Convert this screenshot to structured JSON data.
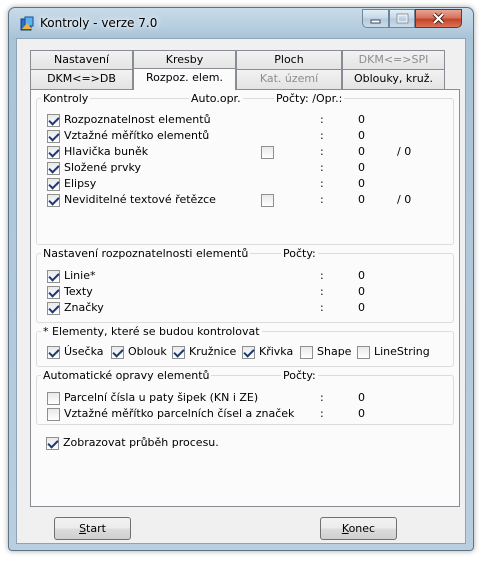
{
  "window": {
    "title": "Kontroly - verze 7.0"
  },
  "tabs_row1": [
    "Nastavení",
    "Kresby",
    "Ploch",
    "DKM<=>SPI"
  ],
  "tabs_row2": [
    "DKM<=>DB",
    "Rozpoz. elem.",
    "Kat. území",
    "Oblouky, kruž."
  ],
  "kontroly": {
    "title": "Kontroly",
    "col_auto": "Auto.opr.",
    "col_counts": "Počty: /Opr.:",
    "items": [
      {
        "label": "Rozpoznatelnost elementů",
        "checked": true,
        "auto": null,
        "colon": ":",
        "count": "0",
        "opr": ""
      },
      {
        "label": "Vztažné měřítko elementů",
        "checked": true,
        "auto": null,
        "colon": ":",
        "count": "0",
        "opr": ""
      },
      {
        "label": "Hlavička buněk",
        "checked": true,
        "auto": false,
        "colon": ":",
        "count": "0",
        "opr": "/ 0"
      },
      {
        "label": "Složené prvky",
        "checked": true,
        "auto": null,
        "colon": ":",
        "count": "0",
        "opr": ""
      },
      {
        "label": "Elipsy",
        "checked": true,
        "auto": null,
        "colon": ":",
        "count": "0",
        "opr": ""
      },
      {
        "label": "Neviditelné textové řetězce",
        "checked": true,
        "auto": false,
        "colon": ":",
        "count": "0",
        "opr": "/ 0"
      }
    ]
  },
  "rozpoznatelnost": {
    "title": "Nastavení rozpoznatelnosti elementů",
    "col_counts": "Počty:",
    "items": [
      {
        "label": "Linie*",
        "checked": true,
        "colon": ":",
        "count": "0"
      },
      {
        "label": "Texty",
        "checked": true,
        "colon": ":",
        "count": "0"
      },
      {
        "label": "Značky",
        "checked": true,
        "colon": ":",
        "count": "0"
      }
    ]
  },
  "elementy": {
    "title": "* Elementy, které se budou kontrolovat",
    "items": [
      {
        "label": "Úsečka",
        "checked": true
      },
      {
        "label": "Oblouk",
        "checked": true
      },
      {
        "label": "Kružnice",
        "checked": true
      },
      {
        "label": "Křivka",
        "checked": true
      },
      {
        "label": "Shape",
        "checked": false
      },
      {
        "label": "LineString",
        "checked": false
      }
    ]
  },
  "opravy": {
    "title": "Automatické opravy elementů",
    "col_counts": "Počty:",
    "items": [
      {
        "label": "Parcelní čísla u paty šipek (KN i ZE)",
        "checked": false,
        "colon": ":",
        "count": "0"
      },
      {
        "label": "Vztažné měřítko parcelních čísel a značek",
        "checked": false,
        "colon": ":",
        "count": "0"
      }
    ]
  },
  "progress_option": {
    "label": "Zobrazovat průběh procesu.",
    "checked": true
  },
  "buttons": {
    "start": {
      "accel": "S",
      "rest": "tart"
    },
    "konec": {
      "accel": "K",
      "rest": "onec"
    }
  }
}
